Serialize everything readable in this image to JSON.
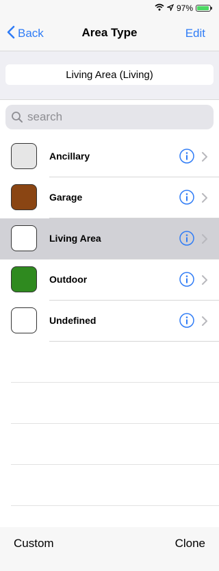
{
  "status": {
    "battery": "97%",
    "battery_level": 0.97
  },
  "nav": {
    "back_label": "Back",
    "title": "Area Type",
    "edit_label": "Edit"
  },
  "selection": {
    "current": "Living Area (Living)"
  },
  "search": {
    "placeholder": "search"
  },
  "items": [
    {
      "label": "Ancillary",
      "color": "#e6e6e6",
      "selected": false
    },
    {
      "label": "Garage",
      "color": "#8a4513",
      "selected": false
    },
    {
      "label": "Living Area",
      "color": "#ffffff",
      "selected": true
    },
    {
      "label": "Outdoor",
      "color": "#2f8a1f",
      "selected": false
    },
    {
      "label": "Undefined",
      "color": "#ffffff",
      "selected": false
    }
  ],
  "toolbar": {
    "custom_label": "Custom",
    "clone_label": "Clone"
  },
  "colors": {
    "accent": "#2f7cf6",
    "selected_row": "#d1d1d6"
  }
}
